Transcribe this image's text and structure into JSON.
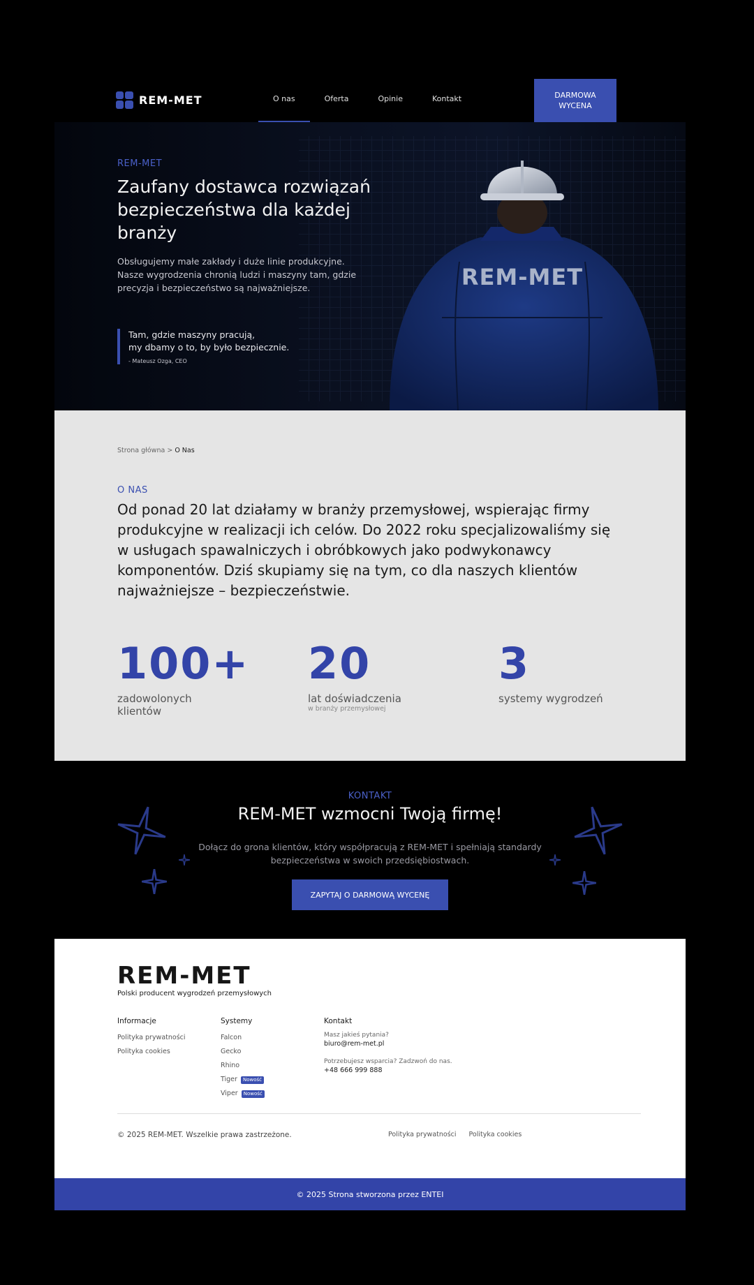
{
  "brand": {
    "name": "REM-MET",
    "accent": "#3a4fb0"
  },
  "nav": {
    "items": [
      {
        "label": "O nas",
        "active": true
      },
      {
        "label": "Oferta"
      },
      {
        "label": "Opinie"
      },
      {
        "label": "Kontakt"
      }
    ],
    "cta_line1": "DARMOWA",
    "cta_line2": "WYCENA"
  },
  "hero": {
    "eyebrow": "REM-MET",
    "title": "Zaufany dostawca rozwiązań bezpieczeństwa dla każdej branży",
    "description": "Obsługujemy małe zakłady i duże linie produkcyjne. Nasze wygrodzenia chronią ludzi i maszyny tam, gdzie precyzja i bezpieczeństwo są najważniejsze.",
    "quote_line1": "Tam, gdzie maszyny pracują,",
    "quote_line2": "my dbamy o to, by było bezpiecznie.",
    "quote_author": "- Mateusz Ozga, CEO",
    "jacket_text": "REM-MET"
  },
  "about": {
    "breadcrumb_home": "Strona główna",
    "breadcrumb_sep": ">",
    "breadcrumb_current": "O Nas",
    "eyebrow": "O NAS",
    "text": "Od ponad 20 lat działamy w branży przemysłowej, wspierając firmy produkcyjne w realizacji ich celów. Do 2022 roku specjalizowaliśmy się w usługach spawalniczych i obróbkowych jako podwykonawcy komponentów. Dziś skupiamy się na tym, co dla naszych klientów najważniejsze – bezpieczeństwie.",
    "stats": [
      {
        "number": "100+",
        "label": "zadowolonych klientów",
        "sub": ""
      },
      {
        "number": "20",
        "label": "lat doświadczenia",
        "sub": "w branży przemysłowej"
      },
      {
        "number": "3",
        "label": "systemy wygrodzeń",
        "sub": ""
      }
    ]
  },
  "contact": {
    "eyebrow": "KONTAKT",
    "title": "REM-MET wzmocni Twoją firmę!",
    "description": "Dołącz do grona klientów, który współpracują z REM-MET i spełniają standardy bezpieczeństwa w swoich przedsiębiostwach.",
    "button": "ZAPYTAJ O DARMOWĄ WYCENĘ"
  },
  "footer": {
    "logo": "REM-MET",
    "tagline": "Polski producent wygrodzeń przemysłowych",
    "info_heading": "Informacje",
    "info_links": [
      "Polityka prywatności",
      "Polityka cookies"
    ],
    "systems_heading": "Systemy",
    "systems": [
      {
        "name": "Falcon",
        "badge": ""
      },
      {
        "name": "Gecko",
        "badge": ""
      },
      {
        "name": "Rhino",
        "badge": ""
      },
      {
        "name": "Tiger",
        "badge": "Nowość"
      },
      {
        "name": "Viper",
        "badge": "Nowość"
      }
    ],
    "contact_heading": "Kontakt",
    "question": "Masz jakieś pytania?",
    "email": "biuro@rem-met.pl",
    "support": "Potrzebujesz wsparcia? Zadzwoń do nas.",
    "phone": "+48 666 999 888",
    "copyright": "© 2025 REM-MET. Wszelkie prawa zastrzeżone.",
    "bottom_links": [
      "Polityka prywatności",
      "Polityka cookies"
    ]
  },
  "credit": "© 2025 Strona stworzona przez ENTEI"
}
